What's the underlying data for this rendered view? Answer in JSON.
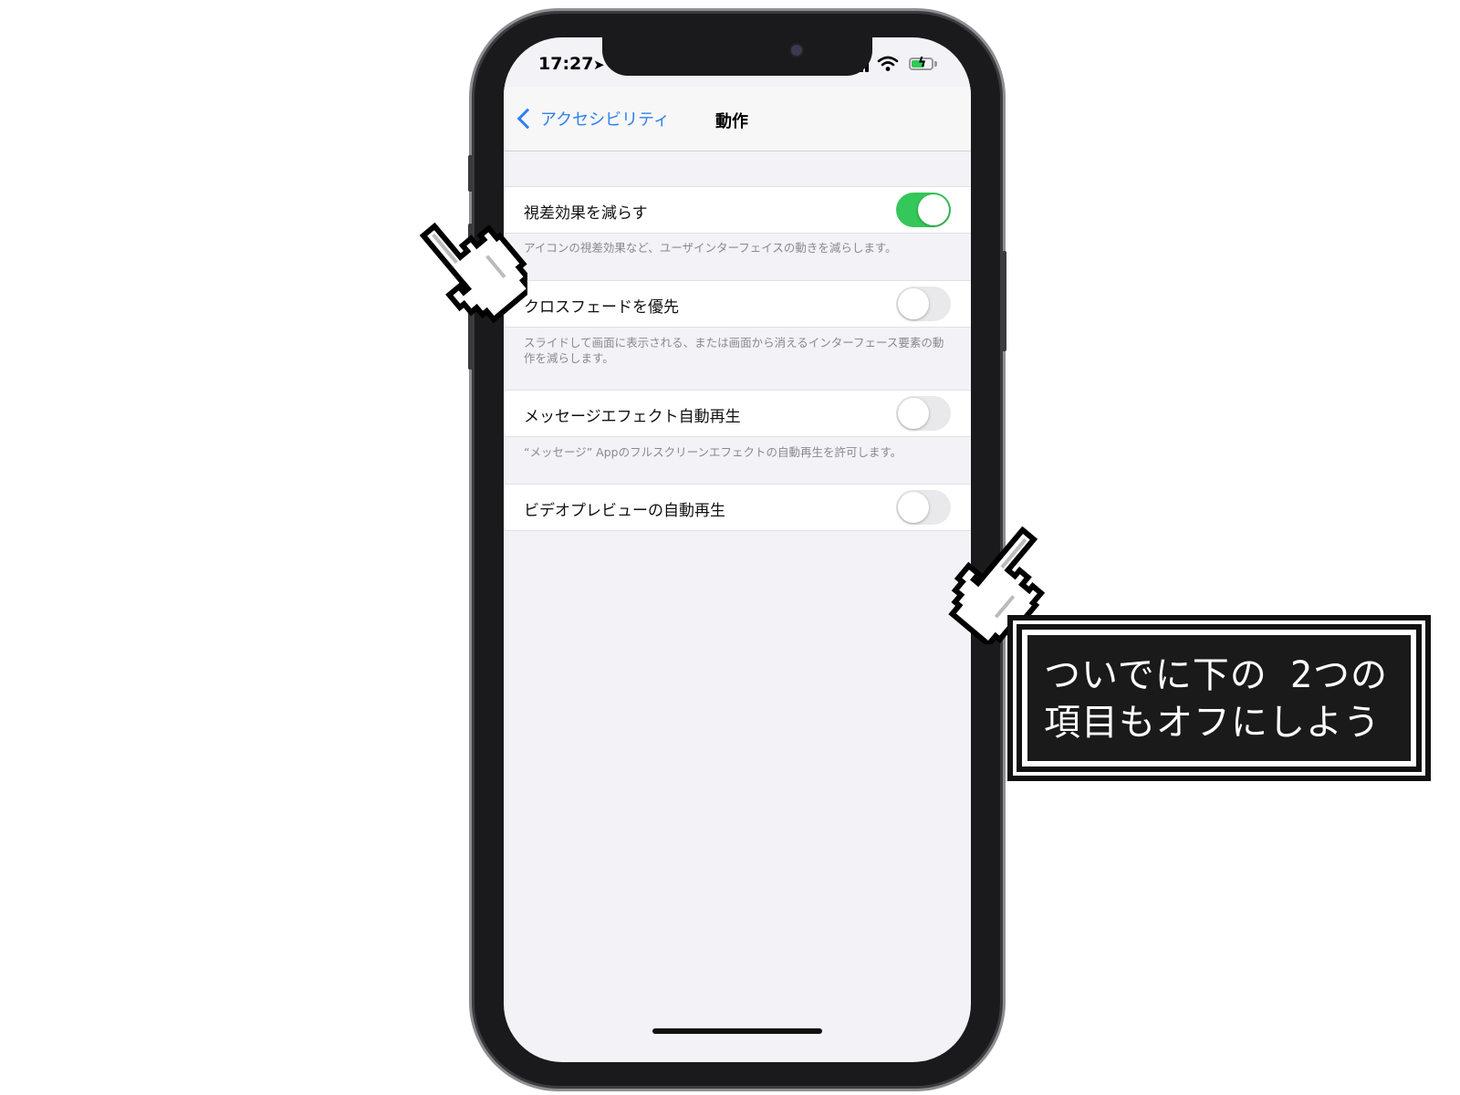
{
  "status_bar": {
    "time": "17:27",
    "location_icon": "location-arrow-icon",
    "signal_icon": "cellular-signal-icon",
    "wifi_icon": "wifi-icon",
    "battery_icon": "battery-charging-icon",
    "battery_color": "#34c759"
  },
  "nav": {
    "back_label": "アクセシビリティ",
    "title": "動作",
    "accent": "#2f80ed"
  },
  "settings": [
    {
      "label": "視差効果を減らす",
      "on": true,
      "footnote": "アイコンの視差効果など、ユーザインターフェイスの動きを減らします。"
    },
    {
      "label": "クロスフェードを優先",
      "on": false,
      "footnote": "スライドして画面に表示される、または画面から消えるインターフェース要素の動作を減らします。"
    },
    {
      "label": "メッセージエフェクト自動再生",
      "on": false,
      "footnote": "“メッセージ” Appのフルスクリーンエフェクトの自動再生を許可します。"
    },
    {
      "label": "ビデオプレビューの自動再生",
      "on": false
    }
  ],
  "callout": {
    "line1": "ついでに下の 2つの",
    "line2": "項目もオフにしよう"
  },
  "cursors": [
    "pointing-hand-cursor-icon",
    "pointing-hand-cursor-icon"
  ]
}
